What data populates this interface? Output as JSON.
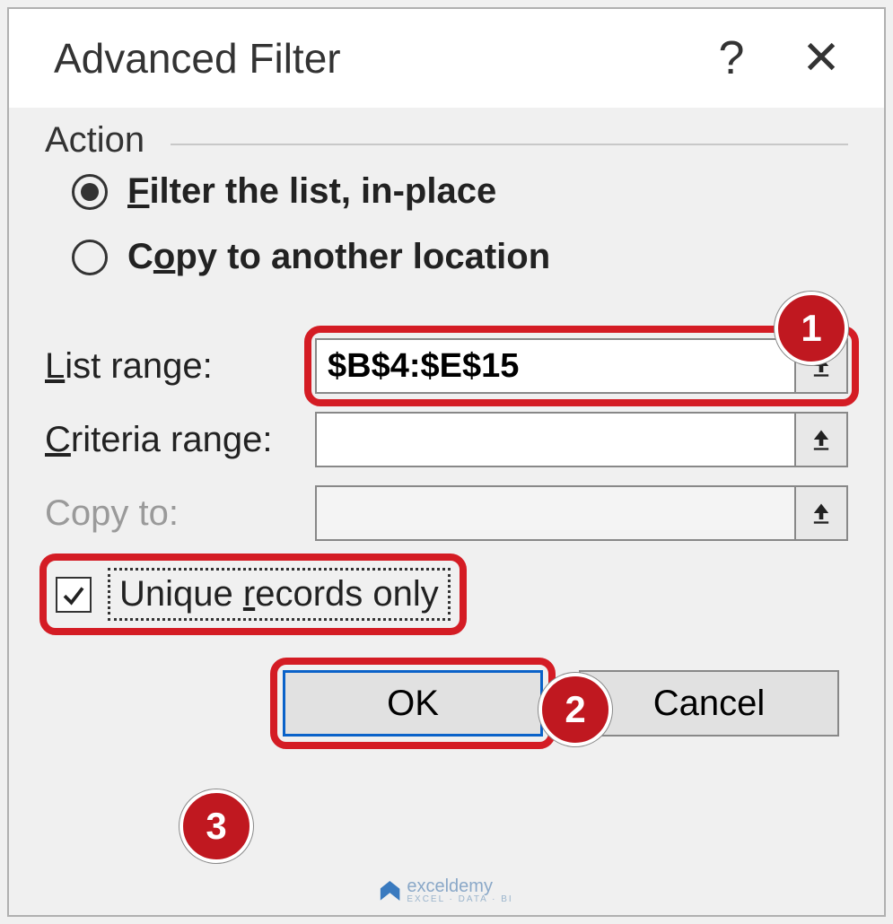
{
  "dialog": {
    "title": "Advanced Filter",
    "help_symbol": "?",
    "close_symbol": "✕"
  },
  "action": {
    "group_label": "Action",
    "filter_pre": "F",
    "filter_rest": "ilter the list, in-place",
    "copy_pre": "C",
    "copy_mid": "o",
    "copy_rest": "py to another location",
    "selected": "filter"
  },
  "fields": {
    "list_label_pre": "L",
    "list_label_rest": "ist range:",
    "list_value": "$B$4:$E$15",
    "criteria_label_pre": "C",
    "criteria_label_rest": "riteria range:",
    "criteria_value": "",
    "copyto_label_pre": "Copy t",
    "copyto_label_rest": "o:",
    "copyto_value": ""
  },
  "checkbox": {
    "label_pre": "Unique ",
    "label_u": "r",
    "label_rest": "ecords only",
    "checked": true
  },
  "buttons": {
    "ok": "OK",
    "cancel": "Cancel"
  },
  "callouts": {
    "one": "1",
    "two": "2",
    "three": "3"
  },
  "watermark": {
    "name": "exceldemy",
    "sub": "EXCEL · DATA · BI"
  }
}
